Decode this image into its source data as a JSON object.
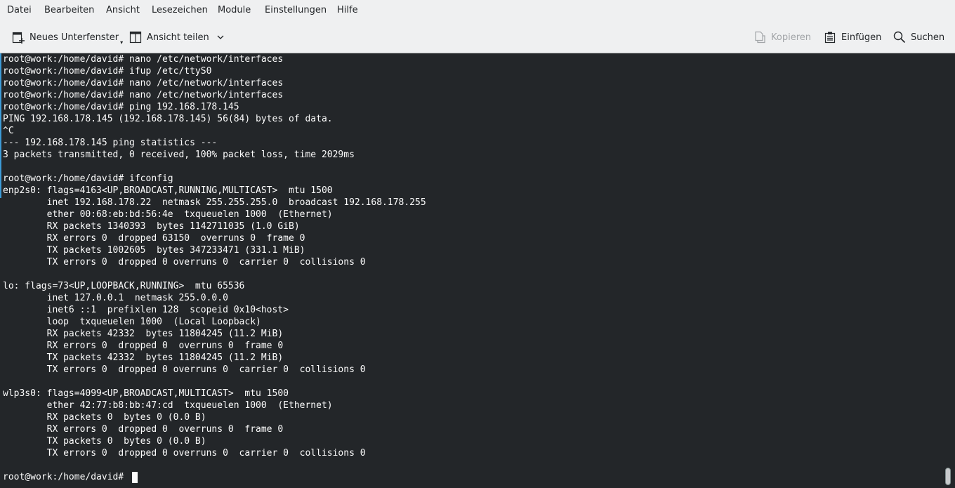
{
  "menubar": {
    "items": [
      "Datei",
      "Bearbeiten",
      "Ansicht",
      "Lesezeichen",
      "Module",
      "Einstellungen",
      "Hilfe"
    ]
  },
  "toolbar": {
    "new_tab_label": "Neues Unterfenster",
    "split_view_label": "Ansicht teilen",
    "copy_label": "Kopieren",
    "copy_enabled": false,
    "paste_label": "Einfügen",
    "search_label": "Suchen"
  },
  "terminal": {
    "lines": [
      "root@work:/home/david# nano /etc/network/interfaces",
      "root@work:/home/david# ifup /etc/ttyS0",
      "root@work:/home/david# nano /etc/network/interfaces",
      "root@work:/home/david# nano /etc/network/interfaces",
      "root@work:/home/david# ping 192.168.178.145",
      "PING 192.168.178.145 (192.168.178.145) 56(84) bytes of data.",
      "^C",
      "--- 192.168.178.145 ping statistics ---",
      "3 packets transmitted, 0 received, 100% packet loss, time 2029ms",
      "",
      "root@work:/home/david# ifconfig",
      "enp2s0: flags=4163<UP,BROADCAST,RUNNING,MULTICAST>  mtu 1500",
      "        inet 192.168.178.22  netmask 255.255.255.0  broadcast 192.168.178.255",
      "        ether 00:68:eb:bd:56:4e  txqueuelen 1000  (Ethernet)",
      "        RX packets 1340393  bytes 1142711035 (1.0 GiB)",
      "        RX errors 0  dropped 63150  overruns 0  frame 0",
      "        TX packets 1002605  bytes 347233471 (331.1 MiB)",
      "        TX errors 0  dropped 0 overruns 0  carrier 0  collisions 0",
      "",
      "lo: flags=73<UP,LOOPBACK,RUNNING>  mtu 65536",
      "        inet 127.0.0.1  netmask 255.0.0.0",
      "        inet6 ::1  prefixlen 128  scopeid 0x10<host>",
      "        loop  txqueuelen 1000  (Local Loopback)",
      "        RX packets 42332  bytes 11804245 (11.2 MiB)",
      "        RX errors 0  dropped 0  overruns 0  frame 0",
      "        TX packets 42332  bytes 11804245 (11.2 MiB)",
      "        TX errors 0  dropped 0 overruns 0  carrier 0  collisions 0",
      "",
      "wlp3s0: flags=4099<UP,BROADCAST,MULTICAST>  mtu 1500",
      "        ether 42:77:b8:bb:47:cd  txqueuelen 1000  (Ethernet)",
      "        RX packets 0  bytes 0 (0.0 B)",
      "        RX errors 0  dropped 0  overruns 0  frame 0",
      "        TX packets 0  bytes 0 (0.0 B)",
      "        TX errors 0  dropped 0 overruns 0  carrier 0  collisions 0",
      "",
      "root@work:/home/david# "
    ]
  },
  "colors": {
    "terminal_background": "#232629",
    "terminal_foreground": "#fcfcfc",
    "chrome_background": "#eff0f1",
    "mark_bar": "#3d9bd7"
  },
  "icons": {
    "new_tab": "new-tab-icon",
    "split_view": "split-view-icon",
    "copy": "copy-icon",
    "paste": "paste-icon",
    "search": "search-icon"
  }
}
